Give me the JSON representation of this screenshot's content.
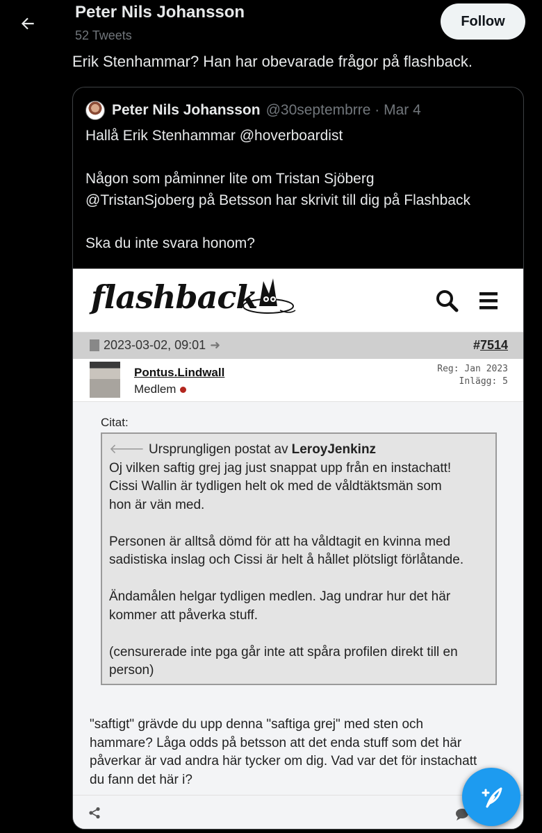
{
  "header": {
    "name": "Peter Nils Johansson",
    "tweet_count": "52 Tweets",
    "follow_label": "Follow"
  },
  "tweet": {
    "text": "Erik Stenhammar? Han har obevarade frågor på flashback."
  },
  "quote": {
    "name": "Peter Nils Johansson",
    "handle_date": "@30septembrre · Mar 4",
    "lines": [
      "Hallå Erik Stenhammar @hoverboardist",
      "",
      "Någon som påminner lite om Tristan Sjöberg",
      "@TristanSjoberg på Betsson har skrivit till dig på Flashback",
      "",
      "Ska du inte svara honom?"
    ]
  },
  "flashback": {
    "logo": "flashback",
    "date": "2023-03-02, 09:01",
    "post_prefix": "#",
    "post_number": "7514",
    "username": "Pontus.Lindwall",
    "role": "Medlem",
    "reg": "Reg: Jan 2023",
    "posts": "Inlägg: 5",
    "citat_label": "Citat:",
    "quote_origin": "Ursprungligen postat av",
    "quote_author": "LeroyJenkinz",
    "quote_lines": [
      "Oj vilken saftig grej jag just snappat upp från en instachatt!",
      "Cissi Wallin är tydligen helt ok med de våldtäktsmän som",
      "hon är vän med.",
      "",
      "Personen är alltså dömd för att ha våldtagit en kvinna med",
      "sadistiska inslag och Cissi är helt å hållet plötsligt förlåtande.",
      "",
      "Ändamålen helgar tydligen medlen. Jag undrar hur det här",
      "kommer att påverka stuff.",
      "",
      "(censurerade inte pga går inte att spåra profilen direkt till en",
      "person)"
    ],
    "reply_lines": [
      "\"saftigt\" grävde du upp denna \"saftiga grej\" med sten och",
      "hammare? Låga odds på betsson att det enda stuff som det här",
      "påverkar är vad andra här tycker om dig. Vad var det för instachatt",
      "du fann det här i?"
    ]
  },
  "colors": {
    "accent": "#1d9bf0",
    "background": "#000000",
    "muted": "#71767b"
  }
}
